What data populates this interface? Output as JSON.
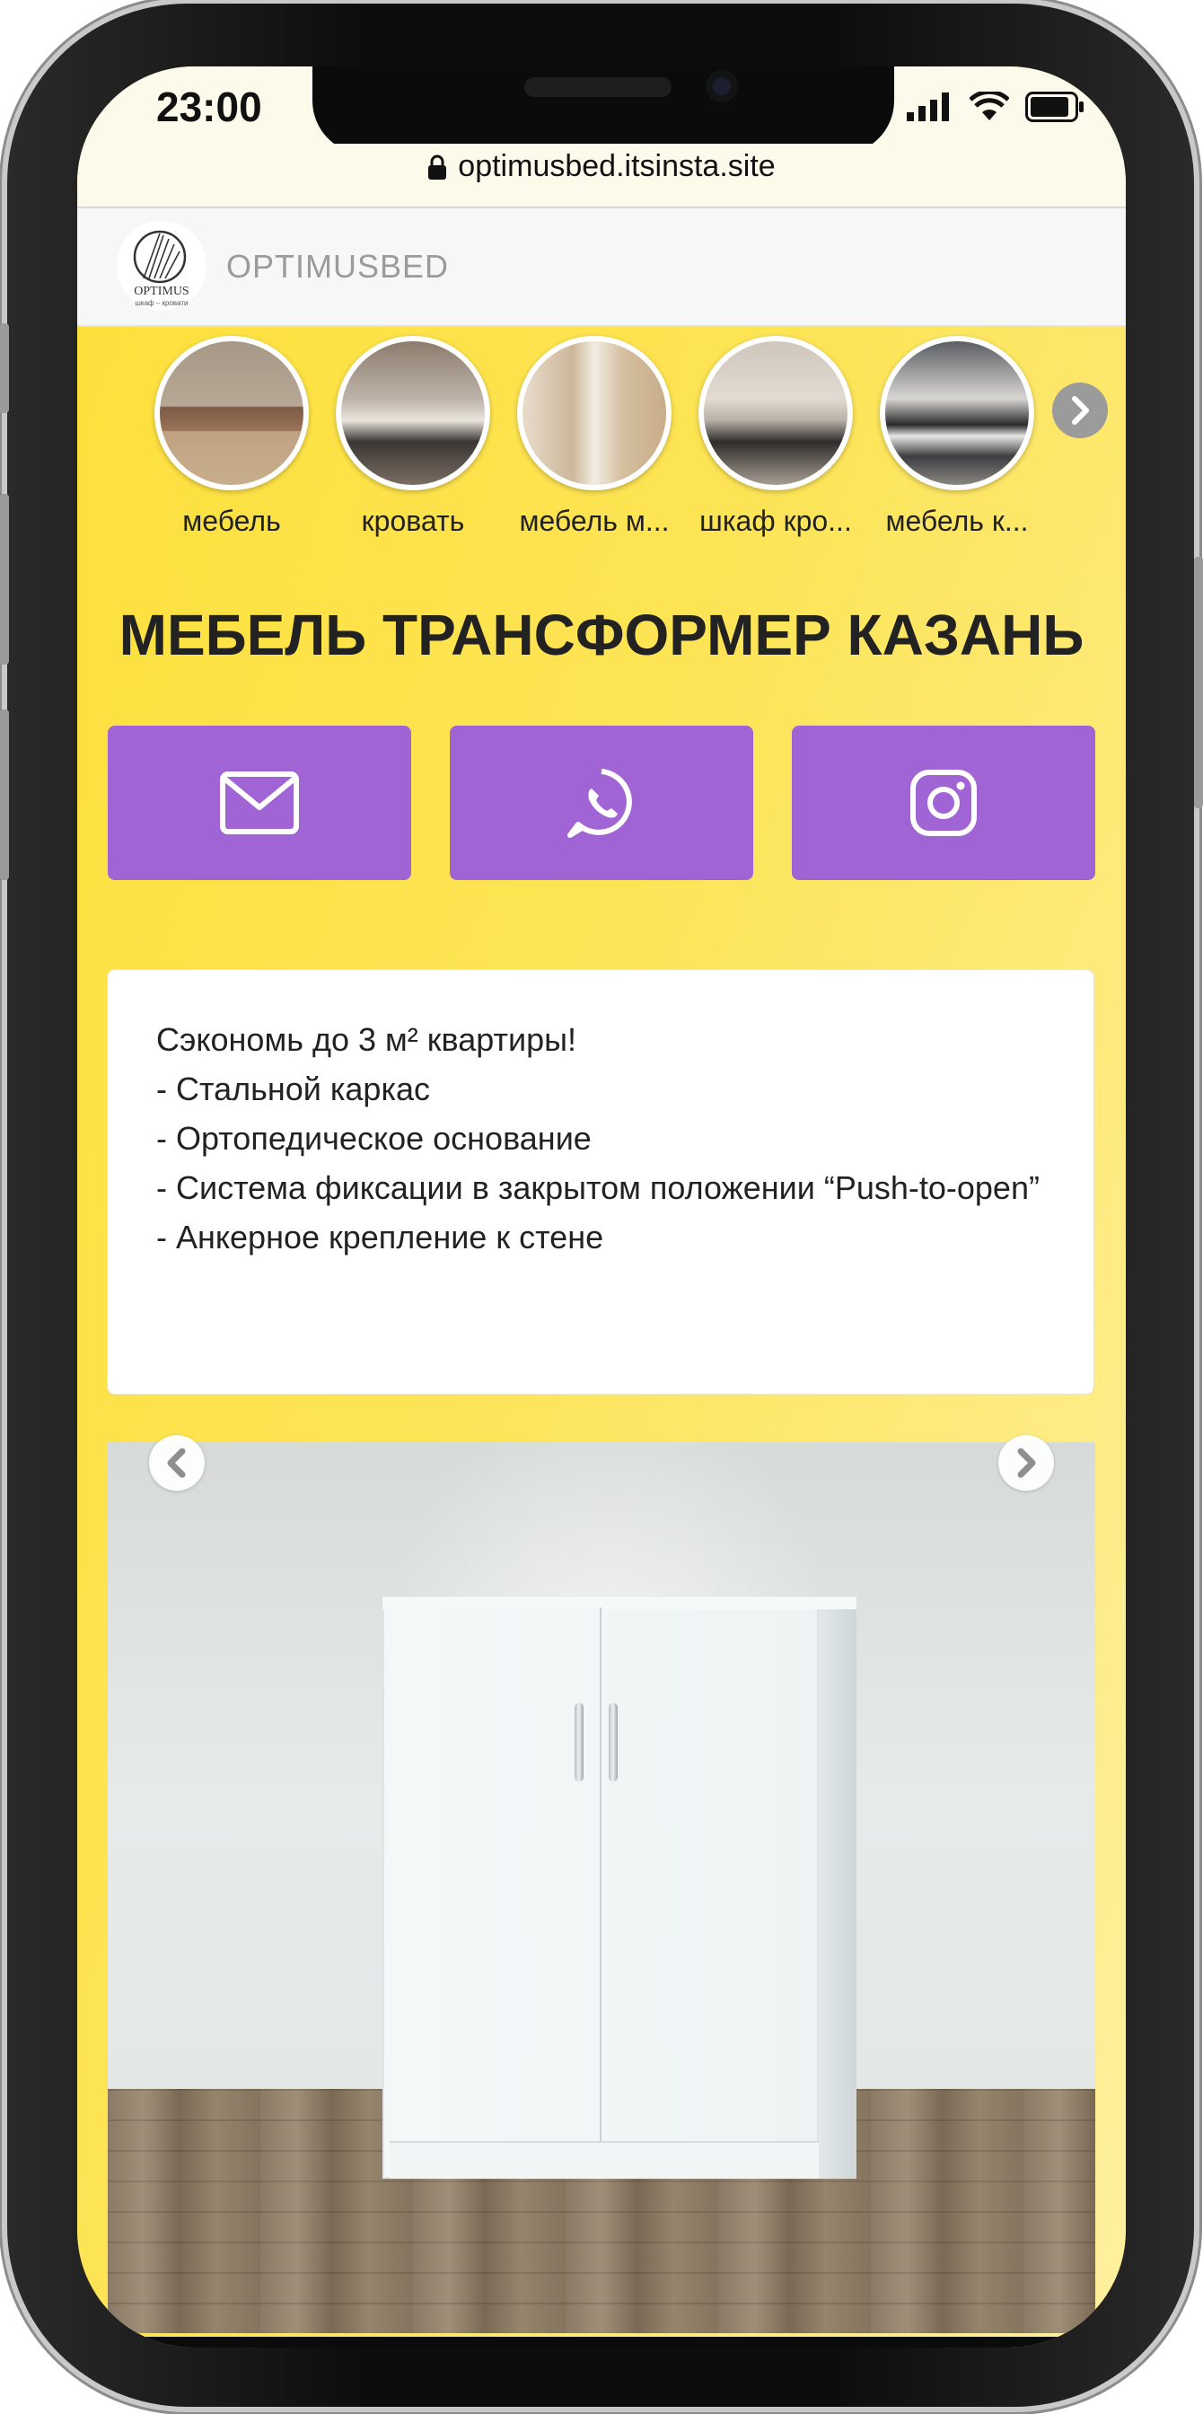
{
  "status": {
    "time": "23:00"
  },
  "browser": {
    "url": "optimusbed.itsinsta.site"
  },
  "header": {
    "logo_name": "Optimus",
    "logo_tagline": "шкаф – кровати",
    "brand": "OPTIMUSBED"
  },
  "stories": [
    {
      "label": "мебель"
    },
    {
      "label": "кровать"
    },
    {
      "label": "мебель м..."
    },
    {
      "label": "шкаф кро..."
    },
    {
      "label": "мебель к..."
    }
  ],
  "page": {
    "title": "МЕБЕЛЬ ТРАНСФОРМЕР КАЗАНЬ"
  },
  "contacts": [
    {
      "icon": "mail-icon"
    },
    {
      "icon": "whatsapp-icon"
    },
    {
      "icon": "instagram-icon"
    }
  ],
  "description": {
    "lines": [
      "Сэкономь до 3 м² квартиры!",
      "- Стальной каркас",
      "- Ортопедическое основание",
      "- Система фиксации в закрытом положении “Push-to-open”",
      "- Анкерное крепление к стене"
    ]
  },
  "colors": {
    "accent": "#a064d4",
    "background": "#fde03a",
    "card": "#ffffff"
  }
}
